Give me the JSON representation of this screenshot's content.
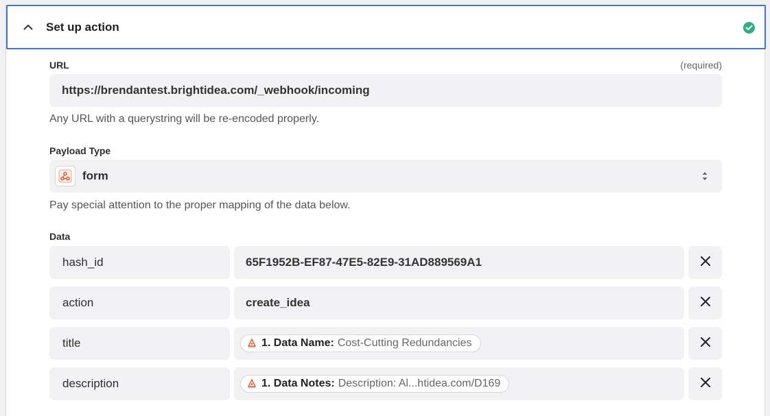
{
  "section": {
    "title": "Set up action"
  },
  "url": {
    "label": "URL",
    "required": "(required)",
    "value": "https://brendantest.brightidea.com/_webhook/incoming",
    "help": "Any URL with a querystring will be re-encoded properly."
  },
  "payload": {
    "label": "Payload Type",
    "value": "form",
    "help": "Pay special attention to the proper mapping of the data below."
  },
  "data": {
    "label": "Data",
    "rows": [
      {
        "key": "hash_id",
        "value": "65F1952B-EF87-47E5-82E9-31AD889569A1"
      },
      {
        "key": "action",
        "value": "create_idea"
      },
      {
        "key": "title",
        "pill_key": "1. Data Name:",
        "pill_value": "Cost-Cutting Redundancies"
      },
      {
        "key": "description",
        "pill_key": "1. Data Notes:",
        "pill_value": "Description: Al...htidea.com/D169"
      }
    ]
  },
  "colors": {
    "accent_border": "#3d74d6",
    "success": "#35ad84",
    "field_bg": "#f2f2f4"
  },
  "icons": {
    "collapse": "chevron-up-icon",
    "status": "check-circle-icon",
    "app": "webhook-icon",
    "select": "sort-arrows-icon",
    "remove": "close-icon"
  }
}
